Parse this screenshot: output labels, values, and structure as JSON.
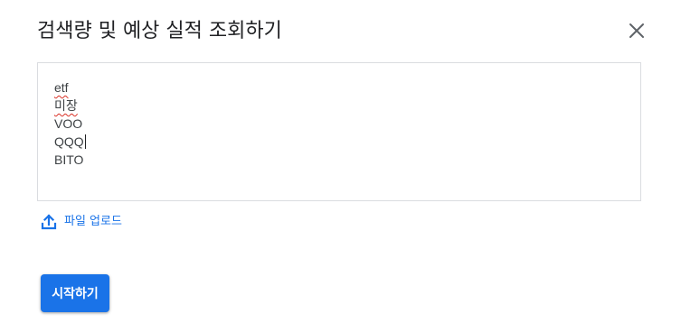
{
  "dialog": {
    "title": "검색량 및 예상 실적 조회하기",
    "close_icon": "close-icon"
  },
  "keywords": {
    "lines": [
      "etf",
      "미장",
      "VOO",
      "QQQ",
      "BITO"
    ],
    "misspelled": [
      "etf",
      "미장"
    ]
  },
  "upload": {
    "icon": "upload-icon",
    "label": "파일 업로드"
  },
  "start_button": {
    "label": "시작하기"
  },
  "colors": {
    "accent": "#1a73e8",
    "title_text": "#202124",
    "body_text": "#3c4043",
    "border": "#dadce0",
    "spellcheck": "#d93025"
  }
}
